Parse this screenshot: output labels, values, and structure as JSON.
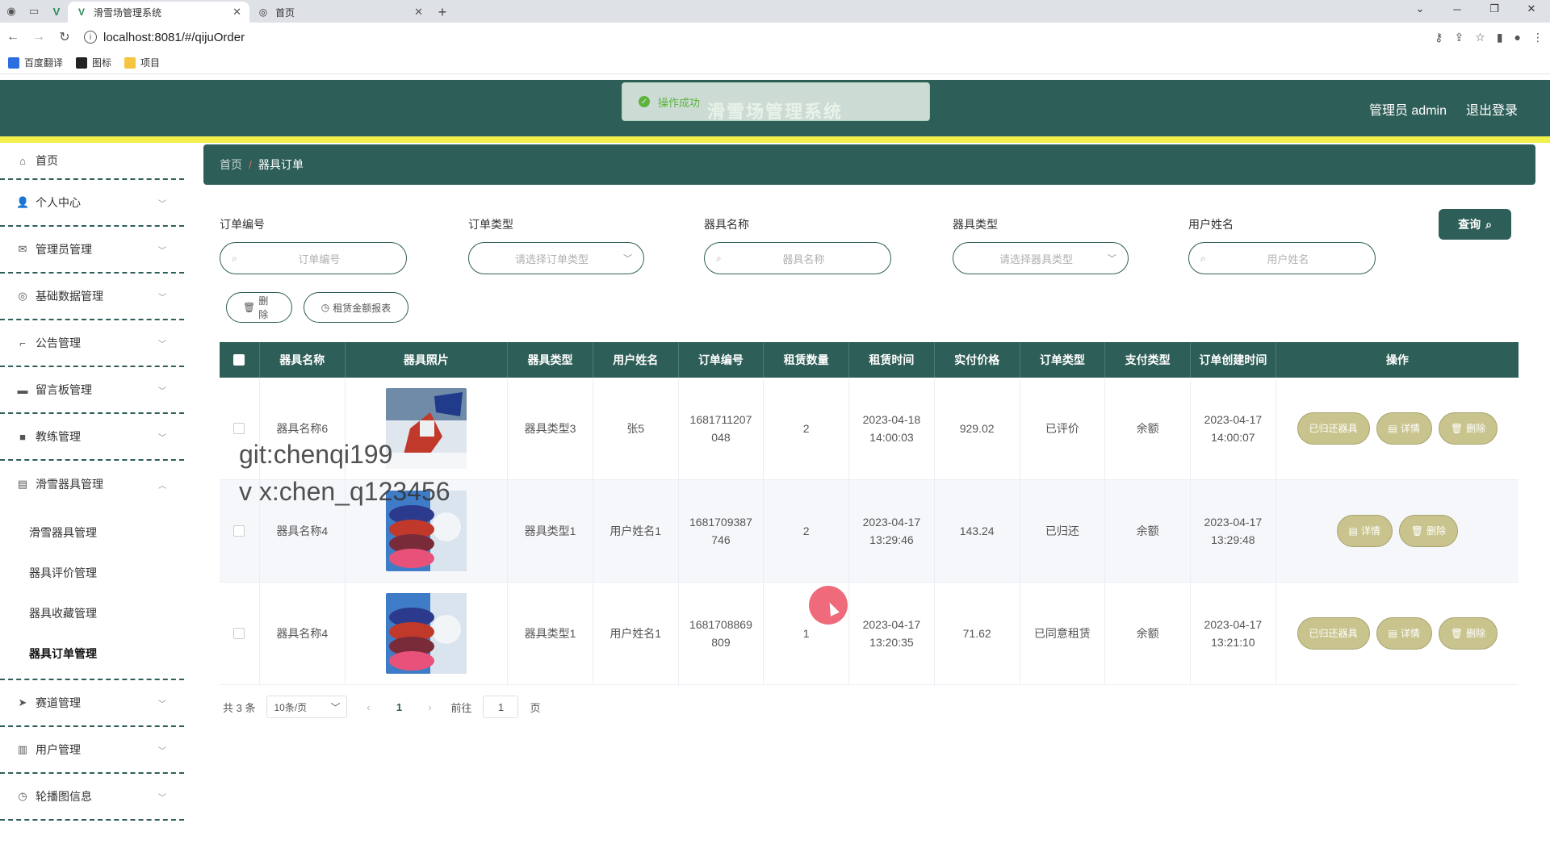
{
  "browser": {
    "tabs": [
      {
        "title": "滑雪场管理系统",
        "active": true
      },
      {
        "title": "首页",
        "active": false
      }
    ],
    "url": "localhost:8081/#/qijuOrder",
    "bookmarks": [
      "百度翻译",
      "图标",
      "项目"
    ]
  },
  "header": {
    "title": "滑雪场管理系统",
    "user_label": "管理员 admin",
    "logout_label": "退出登录",
    "toast": "操作成功"
  },
  "sidebar": {
    "items": [
      {
        "label": "首页",
        "icon": "home-icon"
      },
      {
        "label": "个人中心",
        "icon": "user-icon"
      },
      {
        "label": "管理员管理",
        "icon": "mail-icon"
      },
      {
        "label": "基础数据管理",
        "icon": "compass-icon"
      },
      {
        "label": "公告管理",
        "icon": "crop-icon"
      },
      {
        "label": "留言板管理",
        "icon": "suitcase-icon"
      },
      {
        "label": "教练管理",
        "icon": "camera-icon"
      },
      {
        "label": "滑雪器具管理",
        "icon": "printer-icon",
        "expanded": true
      },
      {
        "label": "赛道管理",
        "icon": "send-icon"
      },
      {
        "label": "用户管理",
        "icon": "clipboard-icon"
      },
      {
        "label": "轮播图信息",
        "icon": "clock-icon"
      }
    ],
    "submenu": [
      "滑雪器具管理",
      "器具评价管理",
      "器具收藏管理",
      "器具订单管理"
    ]
  },
  "breadcrumb": {
    "home": "首页",
    "current": "器具订单"
  },
  "filters": [
    {
      "label": "订单编号",
      "placeholder": "订单编号",
      "type": "input"
    },
    {
      "label": "订单类型",
      "placeholder": "请选择订单类型",
      "type": "select"
    },
    {
      "label": "器具名称",
      "placeholder": "器具名称",
      "type": "input"
    },
    {
      "label": "器具类型",
      "placeholder": "请选择器具类型",
      "type": "select"
    },
    {
      "label": "用户姓名",
      "placeholder": "用户姓名",
      "type": "input"
    }
  ],
  "query_button": "查询",
  "actions": {
    "delete": "删除",
    "report": "租赁金额报表"
  },
  "table": {
    "headers": [
      "器具名称",
      "器具照片",
      "器具类型",
      "用户姓名",
      "订单编号",
      "租赁数量",
      "租赁时间",
      "实付价格",
      "订单类型",
      "支付类型",
      "订单创建时间",
      "操作"
    ],
    "rows": [
      {
        "name": "器具名称6",
        "type": "器具类型3",
        "user": "张5",
        "order_no_1": "1681711207",
        "order_no_2": "048",
        "qty": "2",
        "time_1": "2023-04-18",
        "time_2": "14:00:03",
        "price": "929.02",
        "order_type": "已评价",
        "pay_type": "余额",
        "created_1": "2023-04-17",
        "created_2": "14:00:07",
        "ops": [
          "已归还器具",
          "详情",
          "删除"
        ]
      },
      {
        "name": "器具名称4",
        "type": "器具类型1",
        "user": "用户姓名1",
        "order_no_1": "1681709387",
        "order_no_2": "746",
        "qty": "2",
        "time_1": "2023-04-17",
        "time_2": "13:29:46",
        "price": "143.24",
        "order_type": "已归还",
        "pay_type": "余额",
        "created_1": "2023-04-17",
        "created_2": "13:29:48",
        "ops": [
          "详情",
          "删除"
        ]
      },
      {
        "name": "器具名称4",
        "type": "器具类型1",
        "user": "用户姓名1",
        "order_no_1": "1681708869",
        "order_no_2": "809",
        "qty": "1",
        "time_1": "2023-04-17",
        "time_2": "13:20:35",
        "price": "71.62",
        "order_type": "已同意租赁",
        "pay_type": "余额",
        "created_1": "2023-04-17",
        "created_2": "13:21:10",
        "ops": [
          "已归还器具",
          "详情",
          "删除"
        ]
      }
    ]
  },
  "pagination": {
    "total": "共 3 条",
    "page_size": "10条/页",
    "current": "1",
    "goto_label": "前往",
    "goto_value": "1",
    "page_suffix": "页"
  },
  "watermark": {
    "line1": "git:chenqi199",
    "line2": "v x:chen_q123456"
  },
  "colors": {
    "primary": "#2e5e58",
    "accent": "#f2f04b",
    "op_button": "#c9c48e"
  }
}
